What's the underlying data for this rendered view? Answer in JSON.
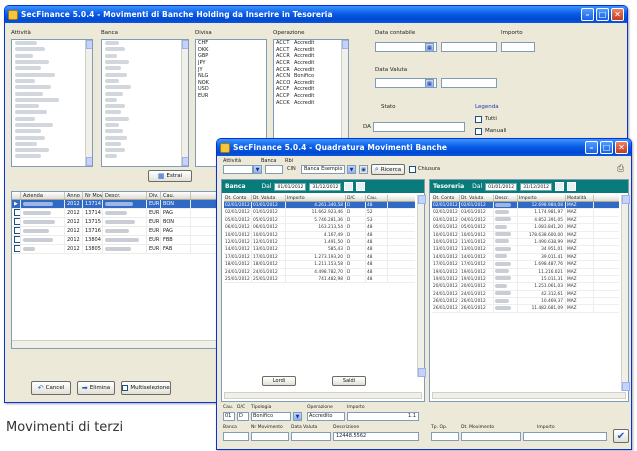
{
  "colors": {
    "titlebar": "#0a5ce6",
    "panel_header": "#0a7b7b",
    "selection": "#316ac5",
    "window_bg": "#ece9d8"
  },
  "main_window": {
    "title": "SecFinance 5.0.4 - Movimenti di Banche Holding da Inserire in Tesoreria",
    "labels": {
      "activity": "Attività",
      "bank": "Banca",
      "currency": "Divisa",
      "operation": "Operazione",
      "accounting_date": "Data contabile",
      "currency_date": "Data Valuta",
      "amount": "Importo",
      "status": "Stato",
      "type": "tipo"
    },
    "currency_list": [
      "CHF",
      "DKK",
      "GBP",
      "JPY",
      "JY",
      "NLG",
      "NOK",
      "USD",
      "EUR"
    ],
    "operation_list": [
      {
        "code": "ACCT",
        "desc": "Accredit"
      },
      {
        "code": "ACCT",
        "desc": "Accredit"
      },
      {
        "code": "ACCR",
        "desc": "Accredit"
      },
      {
        "code": "ACCR",
        "desc": "Accredit"
      },
      {
        "code": "ACCR",
        "desc": "Accredit"
      },
      {
        "code": "ACCN",
        "desc": "Bonifico"
      },
      {
        "code": "ACCO",
        "desc": "Accredit"
      },
      {
        "code": "ACCF",
        "desc": "Accredit"
      },
      {
        "code": "ACCP",
        "desc": "Accredit"
      },
      {
        "code": "ACCK",
        "desc": "Accredit"
      }
    ],
    "legend": {
      "title": "Legenda",
      "opt1": "Tutti",
      "opt2": "Manuali"
    },
    "range_prefix": "DA",
    "filter_button": "Estrai",
    "table": {
      "headers": [
        "",
        "Azienda",
        "Anno",
        "Nr Mov.",
        "Descr.",
        "Div.",
        "Cau."
      ],
      "rows": [
        {
          "anno": "2012",
          "nr": "13714",
          "div": "EUR",
          "cau": "BON"
        },
        {
          "anno": "2012",
          "nr": "13714",
          "div": "EUR",
          "cau": "PAG"
        },
        {
          "anno": "2012",
          "nr": "13715",
          "div": "EUR",
          "cau": "BON"
        },
        {
          "anno": "2012",
          "nr": "13716",
          "div": "EUR",
          "cau": "PAG"
        },
        {
          "anno": "2012",
          "nr": "13804",
          "div": "EUR",
          "cau": "FBB"
        },
        {
          "anno": "2012",
          "nr": "13805",
          "div": "EUR",
          "cau": "FAB"
        }
      ]
    },
    "buttons": {
      "cancel": "Cancel",
      "delete": "Elimina",
      "multi": "Multiselezione"
    }
  },
  "second_window": {
    "title": "SecFinance 5.0.4 - Quadratura Movimenti Banche",
    "labels": {
      "activity": "Attività",
      "bank": "Banca",
      "account": "Rbi",
      "cin": "CIN",
      "bank_name": "Banca Esempio",
      "ricerca": "Ricerca",
      "chk_label": "Chiusura"
    },
    "left_panel": {
      "title": "Banca",
      "range_label": "Dal",
      "date_from": "01/01/2012",
      "date_to": "31/12/2012",
      "headers": [
        "Dt. Conto",
        "Dt. Valuta",
        "Importo",
        "D/C",
        "Cau."
      ],
      "rows": [
        [
          "02/01/2012",
          "01/01/2012",
          "4.261.340,58",
          "D",
          "48"
        ],
        [
          "02/01/2012",
          "01/01/2012",
          "11.662.923,46",
          "D",
          "52"
        ],
        [
          "05/01/2012",
          "05/01/2012",
          "5.746.281,36",
          "D",
          "53"
        ],
        [
          "06/01/2012",
          "06/01/2012",
          "163.213,54",
          "D",
          "48"
        ],
        [
          "10/01/2012",
          "10/01/2012",
          "4.167,49",
          "D",
          "48"
        ],
        [
          "12/01/2012",
          "12/01/2012",
          "1.491,50",
          "D",
          "48"
        ],
        [
          "14/01/2012",
          "13/01/2012",
          "585,43",
          "D",
          "48"
        ],
        [
          "17/01/2012",
          "17/01/2012",
          "1.273.193,20",
          "D",
          "48"
        ],
        [
          "18/01/2012",
          "18/01/2012",
          "1.211.153,58",
          "D",
          "48"
        ],
        [
          "24/01/2012",
          "24/01/2012",
          "4.498.782,70",
          "D",
          "48"
        ],
        [
          "25/01/2012",
          "25/01/2012",
          "741.482,98",
          "D",
          "48"
        ]
      ],
      "footer_left": "Lordi",
      "footer_right": "Saldi"
    },
    "right_panel": {
      "title": "Tesoreria",
      "range_label": "Dal",
      "date_from": "01/01/2012",
      "date_to": "31/12/2012",
      "headers": [
        "Dt. Conto",
        "Dt. Valuta",
        "Importo",
        "Descr.",
        "Modalità"
      ],
      "rows": [
        [
          "02/01/2012",
          "02/01/2012",
          "12.698.984,08",
          "MAZ"
        ],
        [
          "02/01/2012",
          "03/01/2012",
          "1.174.981,97",
          "MAZ"
        ],
        [
          "03/01/2012",
          "04/01/2012",
          "4.852.391,05",
          "MAZ"
        ],
        [
          "05/01/2012",
          "05/01/2012",
          "1.083.841,20",
          "MAZ"
        ],
        [
          "10/01/2012",
          "10/01/2012",
          "178.638.600,00",
          "MAZ"
        ],
        [
          "10/01/2012",
          "11/01/2012",
          "1.490.638,99",
          "MAZ"
        ],
        [
          "13/01/2012",
          "13/01/2012",
          "34.951,01",
          "MAZ"
        ],
        [
          "14/01/2012",
          "14/01/2012",
          "39.011.41",
          "MAZ"
        ],
        [
          "17/01/2012",
          "17/01/2012",
          "1.698.487,76",
          "MAZ"
        ],
        [
          "19/01/2012",
          "19/01/2012",
          "11.216.021",
          "MAZ"
        ],
        [
          "19/01/2012",
          "19/01/2012",
          "15.011,31",
          "MAZ"
        ],
        [
          "20/01/2012",
          "20/01/2012",
          "1.251.061,03",
          "MAZ"
        ],
        [
          "24/01/2012",
          "24/01/2012",
          "42.312,61",
          "MAZ"
        ],
        [
          "26/01/2012",
          "26/01/2012",
          "10.469,37",
          "MAZ"
        ],
        [
          "26/01/2012",
          "26/01/2012",
          "11.482.681,09",
          "MAZ"
        ]
      ]
    },
    "bottom_labels": {
      "f1": "Cau.",
      "f2": "D/C",
      "f3": "Tipologia",
      "f4": "Operazione",
      "f5": "Importo",
      "g1": "Banca",
      "g2": "Nr Movimento",
      "g3": "Data Valuta",
      "g4": "Descrizione",
      "h1": "Tp. Op.",
      "h2": "Dt. Movimento",
      "h3": "Importo"
    },
    "bottom_values": {
      "v1": "01",
      "v2": "D",
      "v3": "Bonifico",
      "v4": "Accredito",
      "v5": "1.1",
      "w4": "12448.5562"
    }
  },
  "caption": "Movimenti di terzi"
}
